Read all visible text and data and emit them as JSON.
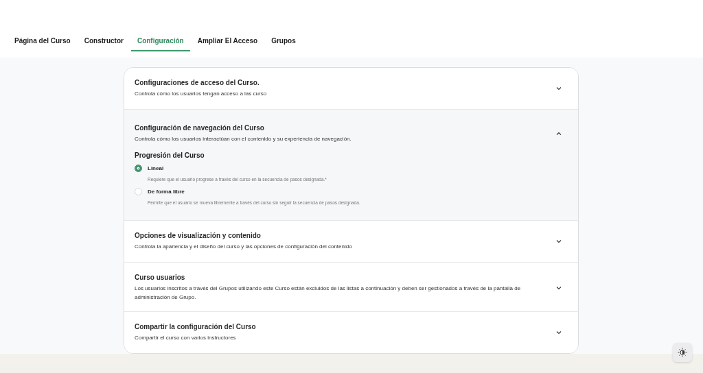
{
  "tabs": [
    {
      "label": "Página del Curso",
      "selected": false
    },
    {
      "label": "Constructor",
      "selected": false
    },
    {
      "label": "Configuración",
      "selected": true
    },
    {
      "label": "Ampliar El Acceso",
      "selected": false
    },
    {
      "label": "Grupos",
      "selected": false
    }
  ],
  "sections": [
    {
      "title": "Configuraciones de acceso del Curso.",
      "description": "Controla cómo los usuarios tengan acceso a las curso",
      "expanded": false
    },
    {
      "title": "Configuración de navegación del Curso",
      "description": "Controla cómo los usuarios interactúan con el contenido y su experiencia de navegación.",
      "expanded": true,
      "group_title": "Progresión del Curso",
      "options": [
        {
          "label": "Lineal",
          "hint": "Requiere que el usuario progrese a través del curso en la secuencia de pasos designada.*",
          "selected": true
        },
        {
          "label": "De forma libre",
          "hint": "Permite que el usuario se mueva libremente a través del curso sin seguir la secuencia de pasos designada.",
          "selected": false
        }
      ]
    },
    {
      "title": "Opciones de visualización y contenido",
      "description": "Controla la apariencia y el diseño del curso y las opciones de configuración del contenido",
      "expanded": false
    },
    {
      "title": "Curso usuarios",
      "description": "Los usuarios inscritos a través del Grupos utilizando este Curso están excluidos de las listas a continuación y deben ser gestionados a través de la pantalla de administración de Grupo.",
      "expanded": false
    },
    {
      "title": "Compartir la configuración del Curso",
      "description": "Compartir el curso con varios instructores",
      "expanded": false
    }
  ]
}
